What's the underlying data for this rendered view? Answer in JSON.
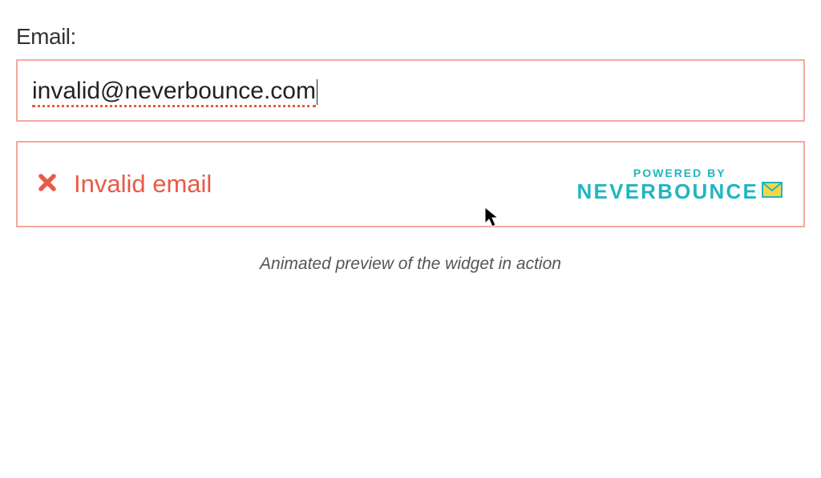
{
  "form": {
    "email_label": "Email:",
    "email_value": "invalid@neverbounce.com"
  },
  "validation": {
    "status_text": "Invalid email",
    "icon": "x-icon"
  },
  "branding": {
    "powered_by": "POWERED BY",
    "brand": "NEVERBOUNCE",
    "brand_icon": "envelope-check-icon"
  },
  "caption": "Animated preview of the widget in action",
  "colors": {
    "error_border": "#f3a99e",
    "error_text": "#e85a47",
    "brand_teal": "#21b5c1",
    "brand_yellow": "#f5d547"
  }
}
